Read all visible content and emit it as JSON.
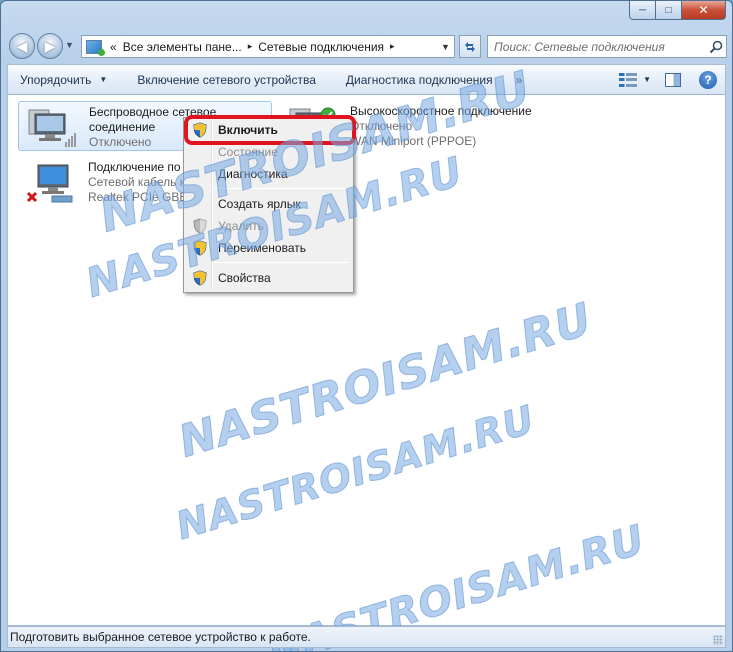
{
  "window": {
    "caption": {
      "minimize": "─",
      "maximize": "□",
      "close": "✕"
    }
  },
  "nav": {
    "back_glyph": "◀",
    "forward_glyph": "▶",
    "address": {
      "prefix": "«",
      "segments": [
        "Все элементы пане...",
        "Сетевые подключения"
      ],
      "separator": "▸"
    },
    "search": {
      "placeholder": "Поиск: Сетевые подключения"
    }
  },
  "toolbar": {
    "items": [
      "Упорядочить",
      "Включение сетевого устройства",
      "Диагностика подключения",
      "»"
    ],
    "organize_arrow": "▼",
    "help": "?"
  },
  "connections": [
    {
      "name": "Беспроводное сетевое",
      "name2": "соединение",
      "status": "Отключено",
      "device": ""
    },
    {
      "name": "Высокоскоростное подключение",
      "status": "Отключено",
      "device": "WAN Miniport (PPPOE)"
    },
    {
      "name": "Подключение по л",
      "status": "Сетевой кабель не",
      "device": "Realtek PCIe GBE Fa"
    }
  ],
  "context_menu": {
    "items": [
      {
        "label": "Включить",
        "bold": true,
        "disabled": false,
        "shield": true
      },
      {
        "label": "Состояние",
        "bold": false,
        "disabled": true,
        "shield": false
      },
      {
        "label": "Диагностика",
        "bold": false,
        "disabled": false,
        "shield": false
      },
      {
        "label": "Создать ярлык",
        "bold": false,
        "disabled": false,
        "shield": false
      },
      {
        "label": "Удалить",
        "bold": false,
        "disabled": true,
        "shield": true
      },
      {
        "label": "Переименовать",
        "bold": false,
        "disabled": false,
        "shield": true
      },
      {
        "label": "Свойства",
        "bold": false,
        "disabled": false,
        "shield": true
      }
    ]
  },
  "watermark": {
    "text": "NASTROISAM.RU"
  },
  "status_bar": {
    "text": "Подготовить выбранное сетевое устройство к работе."
  },
  "colors": {
    "highlight": "#e0141e",
    "accent": "#2f7ac2",
    "watermark": "#78aae1"
  }
}
